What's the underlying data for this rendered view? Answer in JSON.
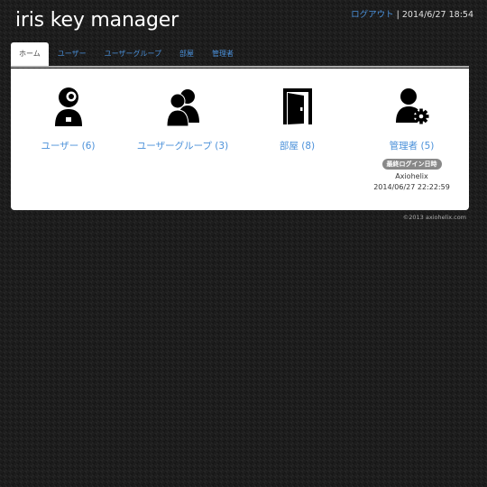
{
  "app": {
    "title": "iris key manager"
  },
  "topbar": {
    "logout": "ログアウト",
    "separator": " | ",
    "datetime": "2014/6/27 18:54"
  },
  "nav": {
    "tabs": [
      {
        "label": "ホーム",
        "active": true
      },
      {
        "label": "ユーザー"
      },
      {
        "label": "ユーザーグループ"
      },
      {
        "label": "部屋"
      },
      {
        "label": "管理者"
      }
    ]
  },
  "dashboard": {
    "cards": [
      {
        "label": "ユーザー (6)",
        "icon": "user-id-icon"
      },
      {
        "label": "ユーザーグループ (3)",
        "icon": "user-group-icon"
      },
      {
        "label": "部屋 (8)",
        "icon": "door-icon"
      },
      {
        "label": "管理者 (5)",
        "icon": "admin-gear-icon",
        "badge": "最終ログイン日時",
        "last_user": "Axiohelix",
        "last_login": "2014/06/27 22:22:59"
      }
    ]
  },
  "footer": {
    "copyright": "©2013 axiohelix.com"
  },
  "colors": {
    "link": "#4a90d9",
    "panel": "#ffffff",
    "badge": "#888888"
  }
}
